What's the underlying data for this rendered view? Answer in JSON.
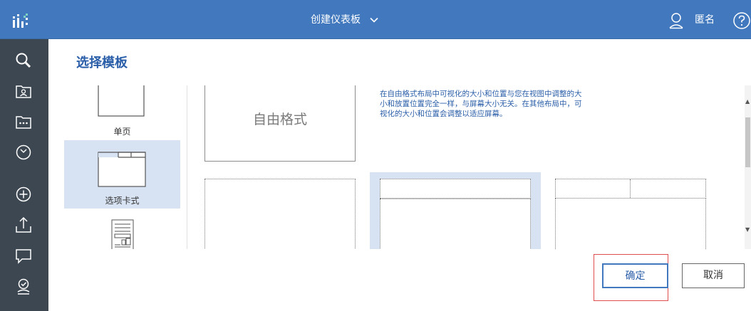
{
  "header": {
    "title": "创建仪表板",
    "user_name": "匿名",
    "colors": {
      "bar": "#4178be",
      "text": "#ffffff"
    }
  },
  "rail": {
    "icons": [
      "search-icon",
      "my-content-icon",
      "team-content-icon",
      "recent-icon",
      "new-icon",
      "upload-icon",
      "chat-icon",
      "manage-icon"
    ]
  },
  "dialog": {
    "title": "选择模板",
    "layouts": [
      {
        "label": "单页",
        "selected": false
      },
      {
        "label": "选项卡式",
        "selected": true
      },
      {
        "label": "",
        "selected": false
      }
    ],
    "free_format_label": "自由格式",
    "free_format_description": "在自由格式布局中可视化的大小和位置与您在视图中调整的大小和放置位置完全一样，与屏幕大小无关。在其他布局中，可视化的大小和位置会调整以适应屏幕。",
    "confirm_label": "确定",
    "cancel_label": "取消",
    "colors": {
      "accent": "#4178be",
      "selected_bg": "#d7e3f2"
    }
  }
}
